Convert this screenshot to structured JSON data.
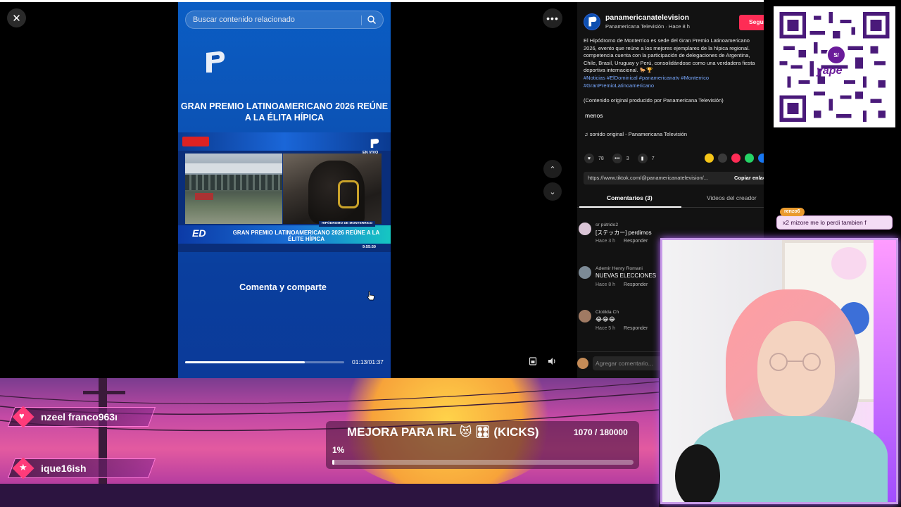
{
  "search": {
    "placeholder": "Buscar contenido relacionado"
  },
  "video": {
    "title": "GRAN PREMIO LATINOAMERICANO 2026 REÚNE A LA ÉLITA HÍPICA",
    "live_badge": "EN VIVO",
    "location_tag": "HIPÓDROMO DE MONTERRICO",
    "news_logo": "ED",
    "lower_third": "GRAN PREMIO LATINOAMERICANO 2026 REÚNE A LA ÉLITE HÍPICA",
    "clock": "9:55:50",
    "cta": "Comenta y comparte",
    "current_time": "01:13",
    "duration": "01:37",
    "time_display": "01:13/01:37",
    "progress_fraction": 0.75
  },
  "post": {
    "author": "panamericanatelevision",
    "author_sub": "Panamericana Televisión · Hace 8 h",
    "follow_label": "Seguir",
    "description_lines": [
      "El Hipódromo de Monterrico es sede del Gran Premio Latinoamericano",
      "2026, evento que reúne a los mejores ejemplares de la hípica regional.",
      "competencia cuenta con la participación de delegaciones de Argentina,",
      "Chile, Brasil, Uruguay y Perú, consolidándose como una verdadera fiesta",
      "deportiva internacional. 🐎🏆"
    ],
    "hashtag_lines": [
      "#Noticias #ElDominical #panamericanatv #Monterrico",
      "#GranPremioLatinoamericano"
    ],
    "original_note": "(Contenido original producido por Panamericana Televisión)",
    "less_label": "menos",
    "sound": "sonido original - Panamericana Televisión",
    "likes": "78",
    "comments": "3",
    "saves": "7",
    "url": "https://www.tiktok.com/@panamericanatelevision/...",
    "copy_label": "Copiar enlace",
    "tab_comments": "Comentarios (3)",
    "tab_creator": "Videos del creador",
    "add_comment_placeholder": "Agregar comentario..."
  },
  "comments": [
    {
      "user": "sr pútrido2",
      "text": "[ステッカー] perdimos",
      "time": "Hace 3 h",
      "reply": "Responder",
      "avatar_color": "#d9c4d6"
    },
    {
      "user": "Ademir Henry Romani",
      "text": "NUEVAS ELECCIONES",
      "time": "Hace 8 h",
      "reply": "Responder",
      "avatar_color": "#7c8a96"
    },
    {
      "user": "Clotilda Ch",
      "text": "😂😂😂",
      "time": "Hace 5 h",
      "reply": "Responder",
      "avatar_color": "#a07a63"
    }
  ],
  "qr": {
    "badge": "S/",
    "word": "yape"
  },
  "chat": {
    "name": "renzo6",
    "message": "x2 mizore me lo perdi tambien f"
  },
  "events": [
    {
      "text": "nzeel   franco963ı"
    },
    {
      "text": "ique16ish"
    }
  ],
  "goal": {
    "title": "MEJORA PARA IRL 😻 🎛 (KICKS)",
    "count": "1070 / 180000",
    "percent_label": "1%",
    "fraction": 0.006
  },
  "colors": {
    "tiktok_red": "#fe2c55",
    "video_blue": "#0a5dc4",
    "hashtag": "#78a8ff",
    "cam_border": "#c79ae8"
  }
}
